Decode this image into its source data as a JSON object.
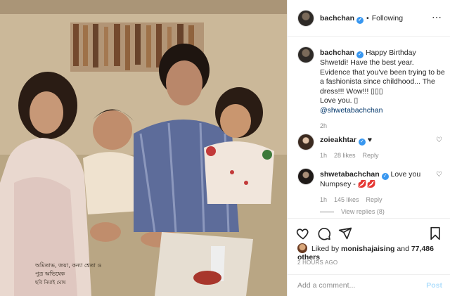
{
  "header": {
    "username": "bachchan",
    "verified_icon": "verified-badge-icon",
    "dot": "•",
    "follow_status": "Following",
    "more_icon": "⋯"
  },
  "photo": {
    "printed_caption_line1": "অমিতাভ, জয়া, কন্যা শ্বেতা ও",
    "printed_caption_line2": "পুত্র অভিষেক",
    "printed_caption_line3": "ছবি নিমাই ঘোষ"
  },
  "caption": {
    "username": "bachchan",
    "text": "Happy Birthday Shwetdi! Have the best year.\nEvidence that you've been trying to be a fashionista since childhood... The dress!!! Wow!!! ▯▯▯\nLove you. ▯",
    "mention": "@shwetabachchan",
    "time": "2h"
  },
  "comments": [
    {
      "username": "zoieakhtar",
      "text": "♥",
      "time": "1h",
      "likes": "28 likes",
      "reply": "Reply",
      "heart_icon": "heart-outline-icon"
    },
    {
      "username": "shwetabachchan",
      "text": "Love you Numpsey - 💋💋",
      "time": "1h",
      "likes": "145 likes",
      "reply": "Reply",
      "heart_icon": "heart-outline-icon"
    }
  ],
  "view_replies": "View replies (8)",
  "actions": {
    "icons": [
      "heart-icon",
      "comment-icon",
      "share-icon",
      "bookmark-icon"
    ]
  },
  "likes": {
    "prefix": "Liked by",
    "user": "monishajaising",
    "and": "and",
    "count": "77,486 others"
  },
  "date": "2 HOURS AGO",
  "add_comment": {
    "placeholder": "Add a comment...",
    "post_label": "Post"
  },
  "colors": {
    "verified": "#3897f0",
    "link": "#003569",
    "muted": "#8e8e8e",
    "post_disabled": "#b2dffc",
    "border": "#efefef"
  }
}
